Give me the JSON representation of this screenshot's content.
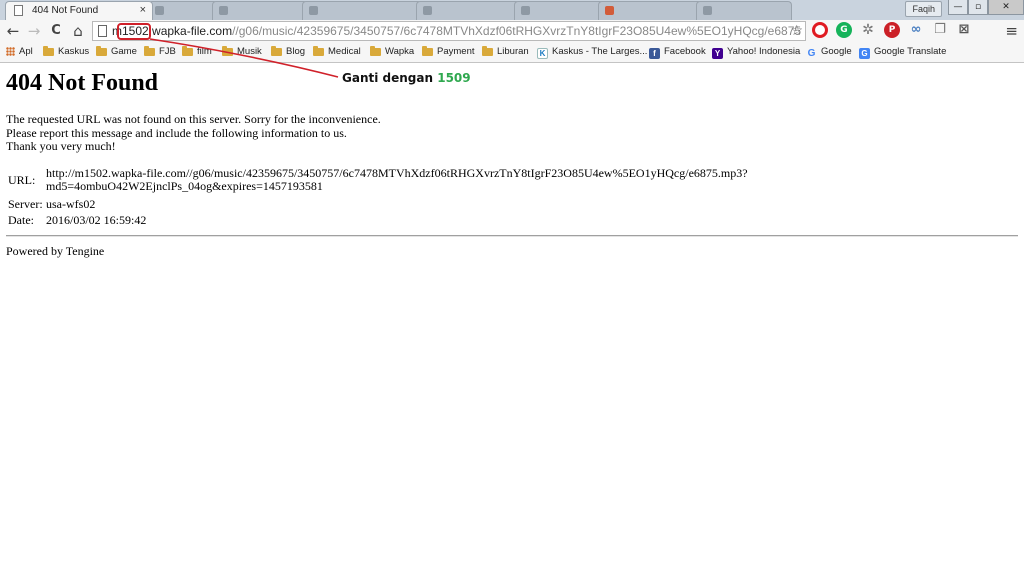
{
  "browser": {
    "active_tab": {
      "title": "404 Not Found",
      "close_glyph": "×"
    },
    "inactive_tabs": [
      "",
      "",
      "",
      "",
      "",
      "",
      ""
    ],
    "user_badge": "Faqih",
    "window_controls": {
      "minimize": "—",
      "maximize": "▫",
      "close": "✕"
    },
    "toolbar": {
      "back_glyph": "←",
      "forward_glyph": "→",
      "reload_glyph": "C",
      "home_glyph": "⌂",
      "url_prefix": "m1502.",
      "url_host": "wapka-file.com",
      "url_path": "//g06/music/42359675/3450757/6c7478MTVhXdzf06tRHGXvrzTnY8tIgrF23O85U4ew%5EO1yHQcg/e6875",
      "star_glyph": "☆",
      "menu_glyph": "≡"
    },
    "extensions": [
      {
        "name": "opera-icon",
        "glyph": ""
      },
      {
        "name": "grammarly-icon",
        "glyph": "G"
      },
      {
        "name": "gear-extension-icon",
        "glyph": "✲"
      },
      {
        "name": "pinterest-icon",
        "glyph": "P"
      },
      {
        "name": "link-extension-icon",
        "glyph": "∞"
      },
      {
        "name": "copy-extension-icon",
        "glyph": "❐"
      },
      {
        "name": "no-crop-extension-icon",
        "glyph": "⊠"
      }
    ],
    "bookmarks": [
      {
        "label": "Apl",
        "icon": "apps"
      },
      {
        "label": "Kaskus",
        "icon": "folder"
      },
      {
        "label": "Game",
        "icon": "folder"
      },
      {
        "label": "FJB",
        "icon": "folder"
      },
      {
        "label": "film",
        "icon": "folder"
      },
      {
        "label": "Musik",
        "icon": "folder"
      },
      {
        "label": "Blog",
        "icon": "folder"
      },
      {
        "label": "Medical",
        "icon": "folder"
      },
      {
        "label": "Wapka",
        "icon": "folder"
      },
      {
        "label": "Payment",
        "icon": "folder"
      },
      {
        "label": "Liburan",
        "icon": "folder"
      },
      {
        "label": "Kaskus - The Larges...",
        "icon": "kaskus",
        "glyph": "K"
      },
      {
        "label": "Facebook",
        "icon": "facebook",
        "glyph": "f"
      },
      {
        "label": "Yahoo! Indonesia",
        "icon": "yahoo",
        "glyph": "Y"
      },
      {
        "label": "Google",
        "icon": "google",
        "glyph": "G"
      },
      {
        "label": "Google Translate",
        "icon": "gtranslate",
        "glyph": "G"
      }
    ]
  },
  "page": {
    "heading": "404 Not Found",
    "paragraph_lines": [
      "The requested URL was not found on this server. Sorry for the inconvenience.",
      "Please report this message and include the following information to us.",
      "Thank you very much!"
    ],
    "info": {
      "url_label": "URL:",
      "url_value_line1": "http://m1502.wapka-file.com//g06/music/42359675/3450757/6c7478MTVhXdzf06tRHGXvrzTnY8tIgrF23O85U4ew%5EO1yHQcg/e6875.mp3?",
      "url_value_line2": "md5=4ombuO42W2EjnclPs_04og&expires=1457193581",
      "server_label": "Server:",
      "server_value": "usa-wfs02",
      "date_label": "Date:",
      "date_value": "2016/03/02 16:59:42"
    },
    "powered_by": "Powered by Tengine"
  },
  "annotation": {
    "text": "Ganti dengan",
    "number": "1509",
    "color": "#d0212a",
    "number_color": "#2fa84f"
  }
}
